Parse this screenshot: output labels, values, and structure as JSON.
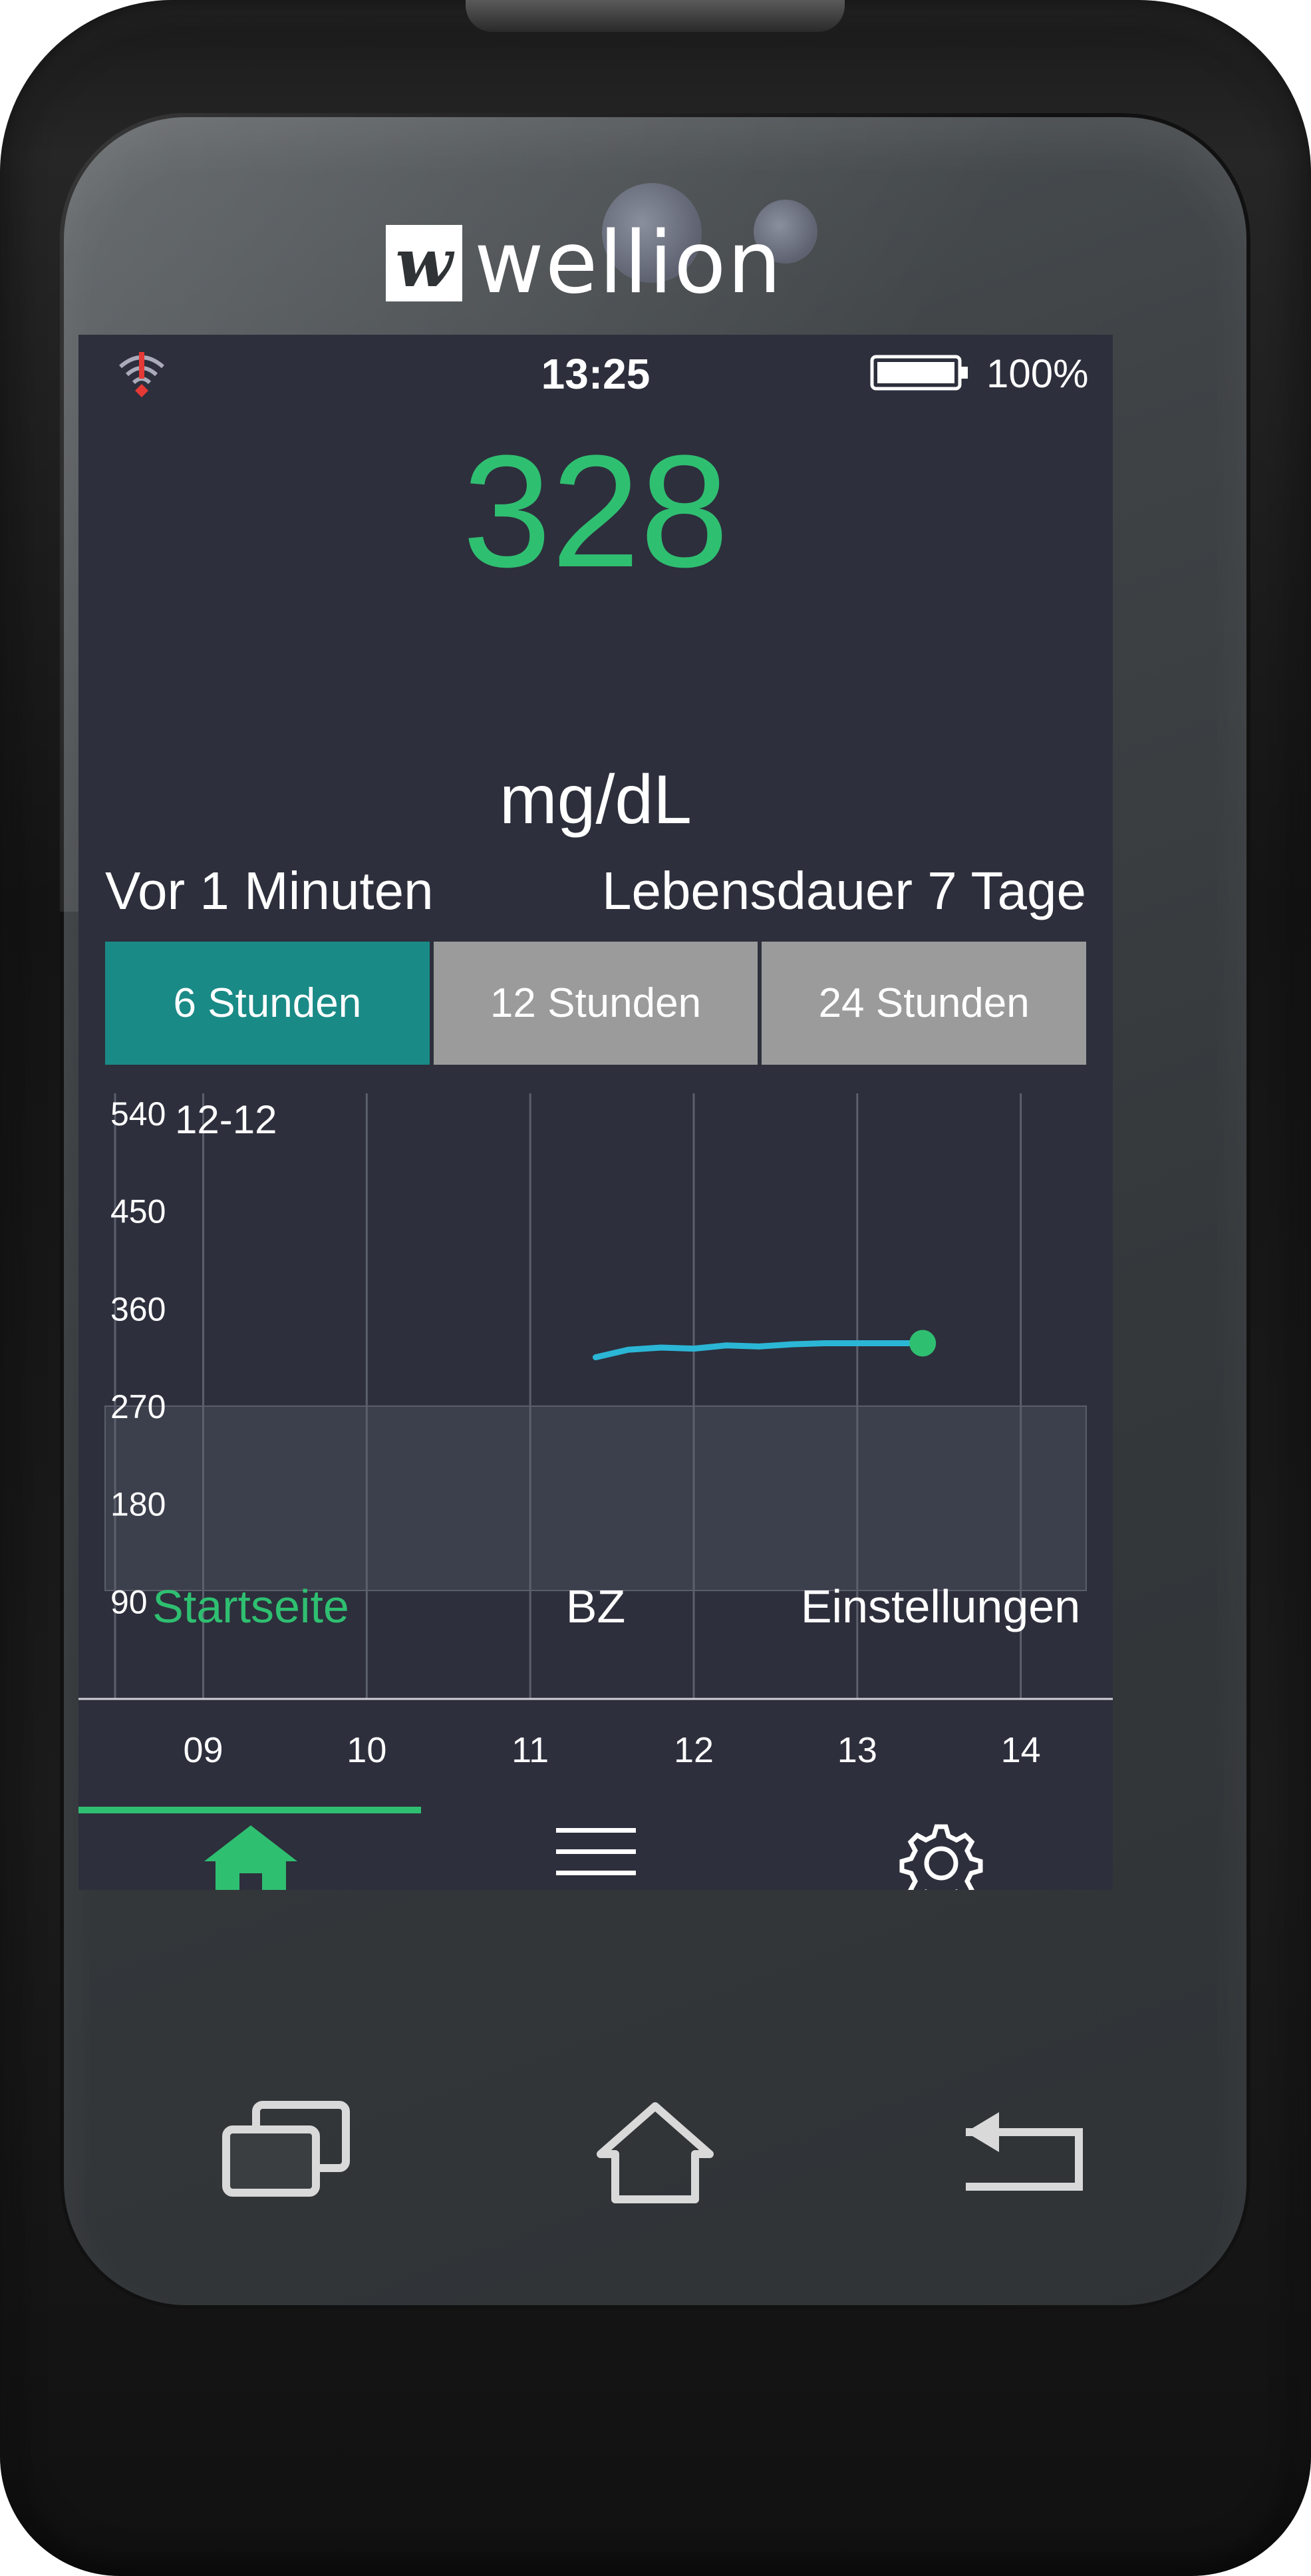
{
  "device": {
    "brand": "wellion",
    "brand_mark": "w"
  },
  "status_bar": {
    "time": "13:25",
    "battery": "100%",
    "battery_level": 1.0
  },
  "reading": {
    "value": "328",
    "unit": "mg/dL",
    "since": "Vor 1 Minuten",
    "sensor_life": "Lebensdauer 7 Tage",
    "value_color": "#2fbf71"
  },
  "range_tabs": [
    {
      "label": "6 Stunden",
      "active": true
    },
    {
      "label": "12 Stunden",
      "active": false
    },
    {
      "label": "24 Stunden",
      "active": false
    }
  ],
  "chart_data": {
    "type": "line",
    "date_label": "12-12",
    "x_ticks": [
      "09",
      "10",
      "11",
      "12",
      "13",
      "14"
    ],
    "y_ticks": [
      540,
      450,
      360,
      270,
      180,
      90
    ],
    "ylim": [
      0,
      540
    ],
    "target_range": [
      100,
      270
    ],
    "grid": true,
    "series": [
      {
        "color": "#2bb6d6",
        "x": [
          11.4,
          11.6,
          11.8,
          12.0,
          12.2,
          12.4,
          12.6,
          12.8,
          13.0,
          13.2,
          13.4
        ],
        "values": [
          315,
          322,
          324,
          323,
          326,
          325,
          327,
          328,
          328,
          328,
          328
        ]
      }
    ],
    "last_point": {
      "x": 13.4,
      "value": 328,
      "color": "#2fbf71"
    }
  },
  "bottom_nav": [
    {
      "label": "Startseite",
      "icon": "home-icon",
      "active": true
    },
    {
      "label": "BZ",
      "icon": "list-icon",
      "active": false
    },
    {
      "label": "Einstellungen",
      "icon": "gear-icon",
      "active": false
    }
  ],
  "hardware_buttons": [
    "recent-apps-icon",
    "home-outline-icon",
    "back-icon"
  ],
  "colors": {
    "accent": "#2fbf71",
    "active_tab": "#1a8a86",
    "screen_bg": "#2d2f3c"
  }
}
